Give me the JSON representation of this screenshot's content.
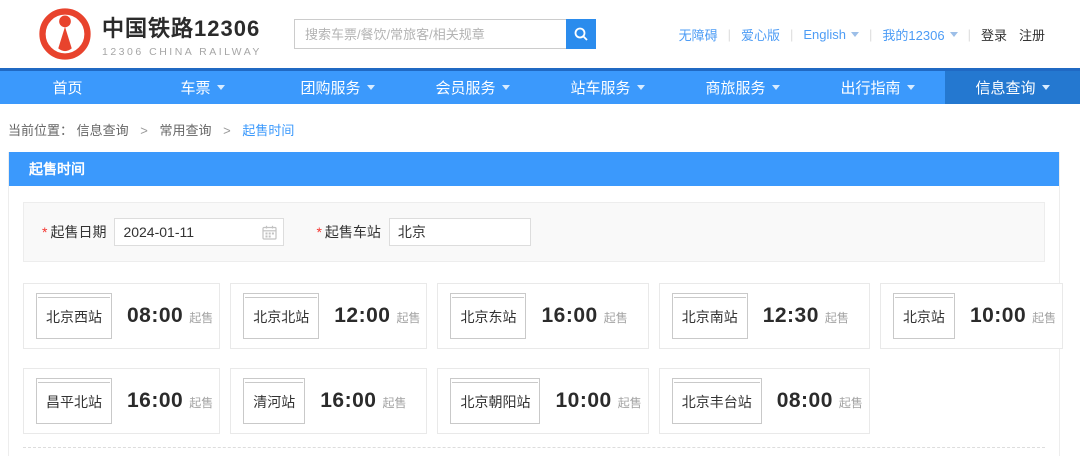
{
  "header": {
    "logo": {
      "title": "中国铁路12306",
      "subtitle": "12306 CHINA RAILWAY"
    },
    "search": {
      "placeholder": "搜索车票/餐饮/常旅客/相关规章",
      "icon": "search-icon"
    },
    "links": {
      "accessibility": "无障碍",
      "care_version": "爱心版",
      "english": "English",
      "my12306": "我的12306",
      "login": "登录",
      "register": "注册"
    }
  },
  "nav": {
    "items": [
      {
        "label": "首页",
        "has_dropdown": false,
        "active": false
      },
      {
        "label": "车票",
        "has_dropdown": true,
        "active": false
      },
      {
        "label": "团购服务",
        "has_dropdown": true,
        "active": false
      },
      {
        "label": "会员服务",
        "has_dropdown": true,
        "active": false
      },
      {
        "label": "站车服务",
        "has_dropdown": true,
        "active": false
      },
      {
        "label": "商旅服务",
        "has_dropdown": true,
        "active": false
      },
      {
        "label": "出行指南",
        "has_dropdown": true,
        "active": false
      },
      {
        "label": "信息查询",
        "has_dropdown": true,
        "active": true
      }
    ]
  },
  "breadcrumb": {
    "prefix": "当前位置：",
    "separator": ">",
    "items": [
      "信息查询",
      "常用查询",
      "起售时间"
    ]
  },
  "section": {
    "title": "起售时间"
  },
  "form": {
    "required_mark": "*",
    "date_label": "起售日期",
    "date_value": "2024-01-11",
    "station_label": "起售车站",
    "station_value": "北京"
  },
  "cards": {
    "sale_suffix": "起售",
    "items": [
      {
        "station": "北京西站",
        "time": "08:00"
      },
      {
        "station": "北京北站",
        "time": "12:00"
      },
      {
        "station": "北京东站",
        "time": "16:00"
      },
      {
        "station": "北京南站",
        "time": "12:30"
      },
      {
        "station": "北京站",
        "time": "10:00"
      },
      {
        "station": "昌平北站",
        "time": "16:00"
      },
      {
        "station": "清河站",
        "time": "16:00"
      },
      {
        "station": "北京朝阳站",
        "time": "10:00"
      },
      {
        "station": "北京丰台站",
        "time": "08:00"
      }
    ]
  },
  "colors": {
    "nav_blue": "#3b99fc",
    "nav_active_blue": "#2478d0",
    "link_blue": "#4d9cf5",
    "logo_red": "#e8432d",
    "search_button_blue": "#2b8ced",
    "required_red": "#f43530"
  }
}
